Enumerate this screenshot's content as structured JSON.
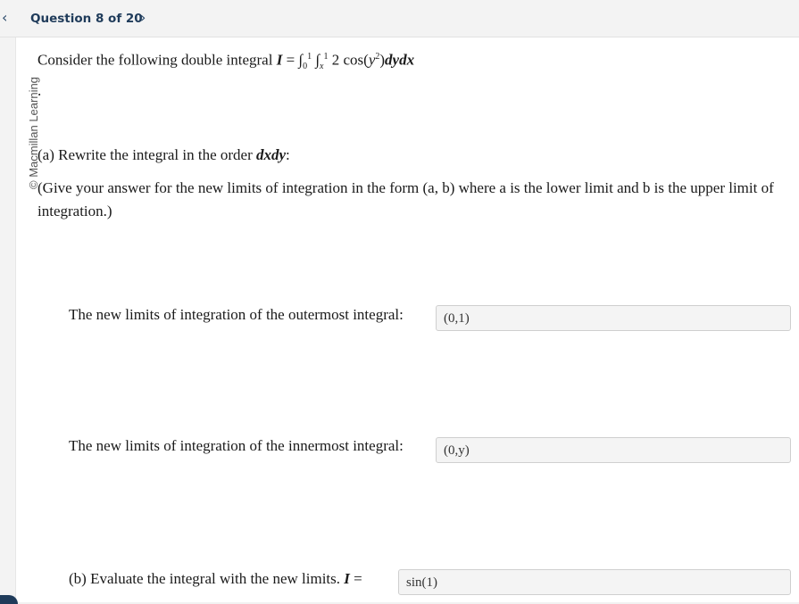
{
  "header": {
    "prev_icon": "‹",
    "next_icon": "›",
    "title": "Question 8 of 20"
  },
  "sidebar": {
    "copyright": "© Macmillan Learning"
  },
  "question": {
    "intro": "Consider the following double integral",
    "integral_var": "I",
    "integral_eq": "=",
    "integrand": "2 cos",
    "integrand_var": "y",
    "integrand_exp": "2",
    "differentials": "dydx",
    "outer_upper": "1",
    "outer_lower": "0",
    "inner_upper": "1",
    "inner_lower": "x",
    "period": ".",
    "part_a": "(a) Rewrite the integral in the order",
    "part_a_order": "dxdy",
    "part_a_colon": ":",
    "instruction_line1": "(Give your answer for the new limits of integration in the form (a, b) where a is the lower limit and b is the upper limit of",
    "instruction_line2": "integration.)",
    "outer_label": "The new limits of integration of the outermost integral:",
    "outer_answer": "(0,1)",
    "inner_label": "The new limits of integration of the innermost integral:",
    "inner_answer": "(0,y)",
    "part_b": "(b) Evaluate the integral with the new limits.",
    "part_b_var": "I",
    "part_b_eq": "=",
    "part_b_answer": "sin(1)"
  }
}
